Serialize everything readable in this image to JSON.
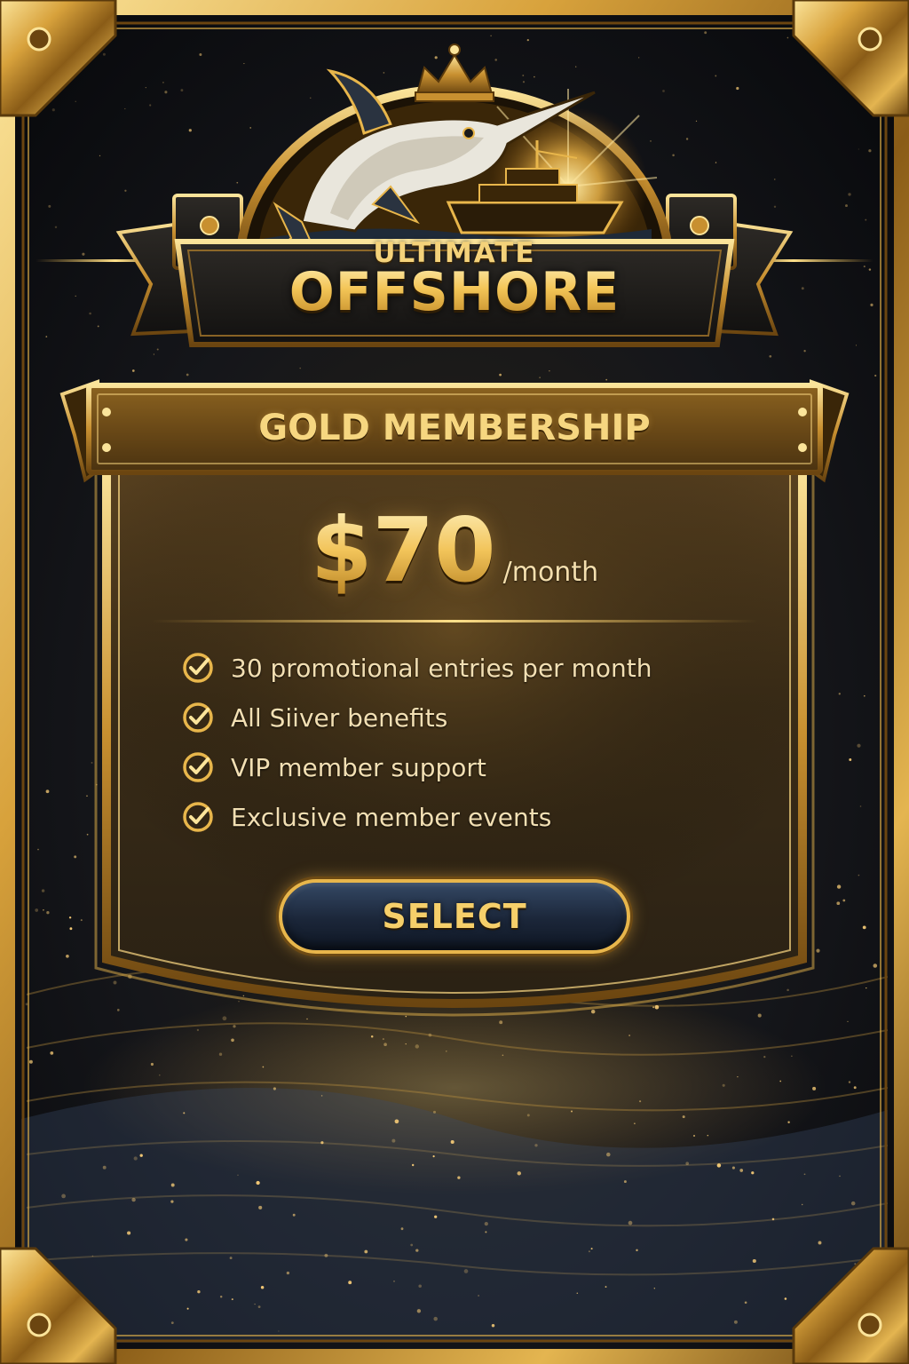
{
  "brand": {
    "line1": "ULTIMATE",
    "line2": "OFFSHORE"
  },
  "plan": {
    "title": "GOLD MEMBERSHIP",
    "price": "$70",
    "period": "/month",
    "features": [
      {
        "text": "30 promotional entries per month",
        "icon": "checkmark-circle-icon"
      },
      {
        "text": "All Siiver benefits",
        "icon": "checkmark-circle-icon"
      },
      {
        "text": "VIP member support",
        "icon": "checkmark-circle-icon"
      },
      {
        "text": "Exclusive member events",
        "icon": "checkmark-circle-icon"
      }
    ],
    "cta_label": "SELECT"
  },
  "colors": {
    "gold": "#e8b64b",
    "gold_light": "#fbe49a",
    "gold_dark": "#7a5214",
    "background": "#0d0f14",
    "button_navy": "#1b2639"
  },
  "icons": {
    "crown": "crown-icon",
    "marlin": "marlin-icon",
    "yacht": "yacht-icon",
    "check": "checkmark-circle-icon"
  }
}
